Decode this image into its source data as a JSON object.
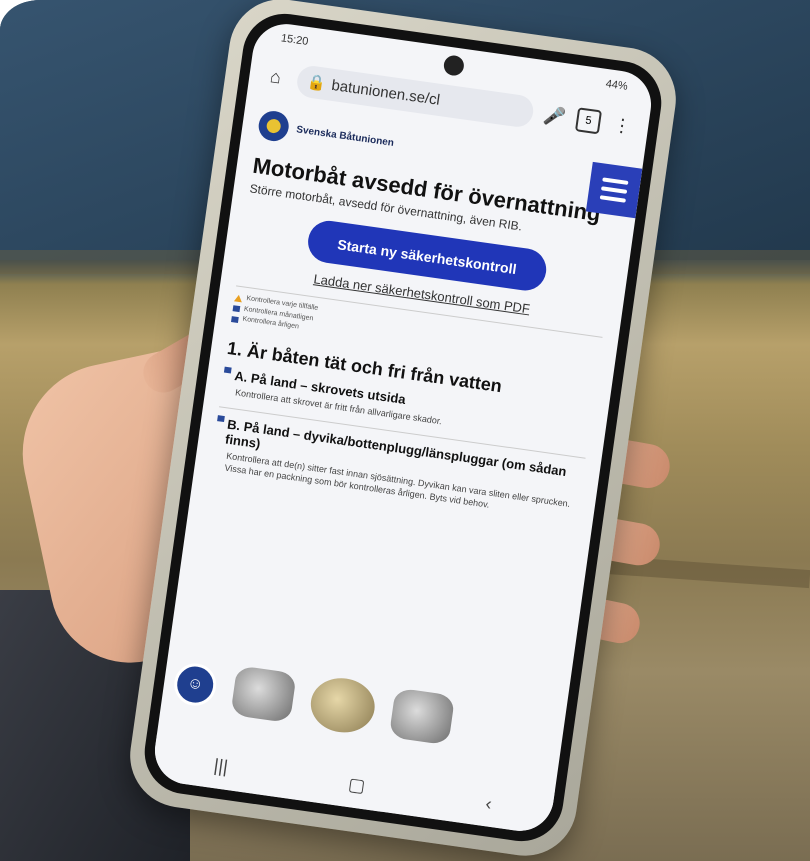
{
  "status": {
    "time": "15:20",
    "indicators": "44%"
  },
  "browser": {
    "url": "batunionen.se/cl",
    "tab_count": "5"
  },
  "site": {
    "brand": "Svenska Båtunionen"
  },
  "page": {
    "title": "Motorbåt avsedd för övernattning",
    "subtitle": "Större motorbåt, avsedd för övernattning, även RIB.",
    "start_button": "Starta ny säkerhetskontroll",
    "pdf_link": "Ladda ner säkerhetskontroll som PDF",
    "legend": [
      "Kontrollera varje tillfälle",
      "Kontrollera månatligen",
      "Kontrollera årligen"
    ],
    "section_title": "1. Är båten tät och fri från vatten",
    "items": [
      {
        "title": "A. På land – skrovets utsida",
        "desc": "Kontrollera att skrovet är fritt från allvarligare skador."
      },
      {
        "title": "B. På land – dyvika/bottenplugg/länspluggar (om sådan finns)",
        "desc": "Kontrollera att de(n) sitter fast innan sjösättning. Dyvikan kan vara sliten eller sprucken. Vissa har en packning som bör kontrolleras årligen. Byts vid behov."
      }
    ]
  },
  "colors": {
    "accent": "#2036b8",
    "brand_blue": "#1f3f8f"
  },
  "icons": [
    "home-icon",
    "lock-icon",
    "mic-icon",
    "more-icon",
    "menu-icon",
    "chat-icon"
  ]
}
